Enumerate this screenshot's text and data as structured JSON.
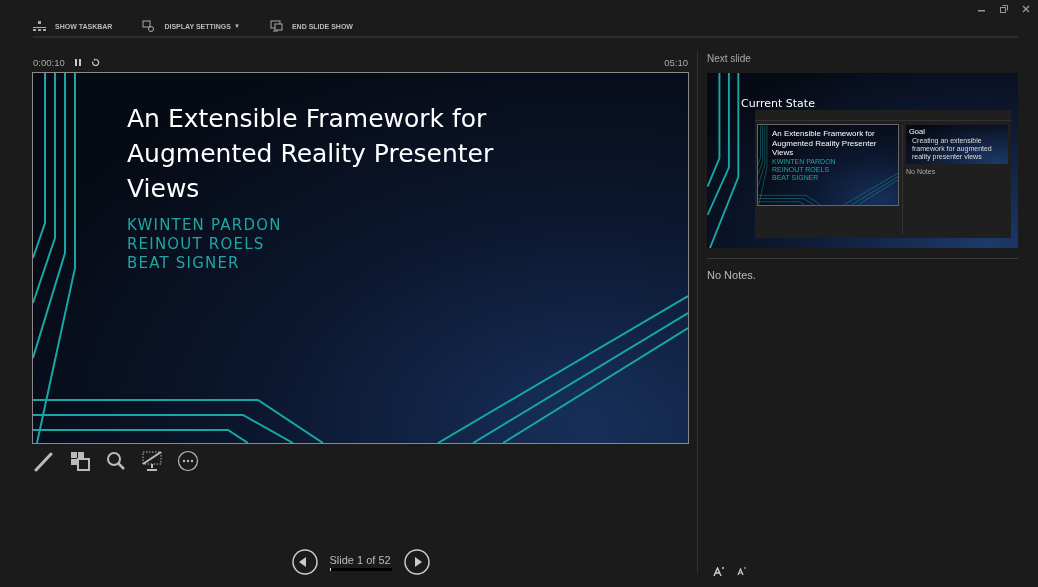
{
  "toolbar": [
    {
      "kind": "taskbar",
      "label": "SHOW TASKBAR"
    },
    {
      "kind": "display",
      "label": "DISPLAY SETTINGS",
      "caret": "▼"
    },
    {
      "kind": "end",
      "label": "END SLIDE SHOW"
    }
  ],
  "timer": {
    "elapsed": "0:00:10",
    "clock": "05:10"
  },
  "current_slide": {
    "title": "An Extensible Framework for Augmented Reality Presenter Views",
    "authors": [
      "KWINTEN PARDON",
      "REINOUT ROELS",
      "BEAT SIGNER"
    ]
  },
  "navigation": {
    "label": "Slide 1 of 52",
    "level": 0.02
  },
  "next_slide": {
    "heading": "Next slide",
    "title": "Current State",
    "screenshot": {
      "slide_title": "An Extensible Framework for Augmented Reality Presenter Views",
      "authors": [
        "KWINTEN PARDON",
        "REINOUT ROELS",
        "BEAT SIGNER"
      ],
      "next_title": "Goal",
      "next_text": "Creating an extensible framework for augmented reality presenter views",
      "notes": "No Notes"
    }
  },
  "notes": {
    "text": "No Notes."
  }
}
